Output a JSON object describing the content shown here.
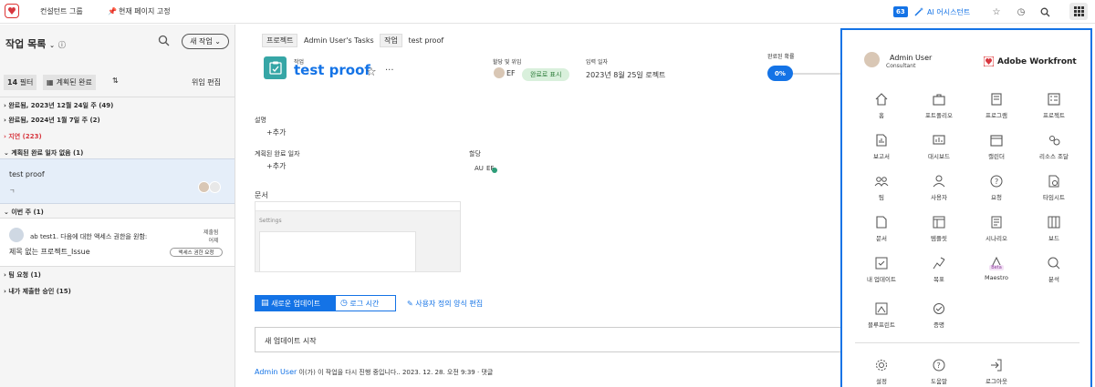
{
  "topbar": {
    "link1": "컨설턴트 그룹",
    "link2": "현재 페이지 고정",
    "badge": "63",
    "ai": "AI 어시스턴트"
  },
  "left": {
    "title": "작업 목록",
    "new_button": "새 작업",
    "filter_count": "14",
    "filter_label": "필터",
    "planned_done": "계획된 완료",
    "delegate_edit": "위임 편집",
    "sections": [
      {
        "label": "완료됨, 2023년 12월 24일 주 (49)",
        "red": false
      },
      {
        "label": "완료됨, 2024년 1월 7일 주 (2)",
        "red": false
      },
      {
        "label": "지연 (223)",
        "red": true
      },
      {
        "label": "계획된 완료 일자 없음 (1)",
        "red": false
      }
    ],
    "selected_item": "test proof",
    "selected_sub": "ㄱ",
    "this_week": "이번 주 (1)",
    "access_request": "ab test1. 다음에 대한 액세스 권한을 원함:",
    "access_project": "제목 없는 프로젝트_Issue",
    "access_status1": "제출됨",
    "access_status2": "어제",
    "access_button": "액세스 권한 요청",
    "team_requests": "팀 요청 (1)",
    "my_approvals": "내가 제출한 승인 (15)"
  },
  "main": {
    "crumb_project_label": "프로젝트",
    "crumb_project": "Admin User's Tasks",
    "crumb_task_label": "작업",
    "crumb_task": "test proof",
    "task_type": "작업",
    "title": "test proof",
    "assign_label": "할당 및 위임",
    "assign_initials": "EF",
    "assign_pill": "완료로 표시",
    "entry_label": "입력 일자",
    "entry_value": "2023년 8월 25일 로젝트",
    "complete_label": "완료된 확률",
    "complete_pct": "0%",
    "desc_label": "설명",
    "desc_add": "+추가",
    "planned_label": "계획된 완료 일자",
    "planned_add": "+추가",
    "assign2_label": "할당",
    "assign2_a": "AU",
    "assign2_b": "EF",
    "doc_label": "문서",
    "doc_settings": "Settings",
    "tab_updates": "새로운 업데이트",
    "tab_log": "로그 시간",
    "edit_custom": "사용자 정의 양식 편집",
    "update_placeholder": "새 업데이트 시작",
    "footer_user": "Admin User",
    "footer_text": "이(가) 이 작업을 다시 진행 중입니다.. 2023. 12. 28. 오전 9:39 ·",
    "footer_reply": "댓글"
  },
  "panel": {
    "user_name": "Admin User",
    "user_role": "Consultant",
    "brand": "Adobe Workfront",
    "apps": [
      {
        "label": "홈",
        "icon": "home-icon"
      },
      {
        "label": "포트폴리오",
        "icon": "portfolio-icon"
      },
      {
        "label": "프로그램",
        "icon": "program-icon"
      },
      {
        "label": "프로젝트",
        "icon": "project-icon"
      },
      {
        "label": "보고서",
        "icon": "report-icon"
      },
      {
        "label": "대시보드",
        "icon": "dashboard-icon"
      },
      {
        "label": "캘린더",
        "icon": "calendar-icon"
      },
      {
        "label": "리소스 조달",
        "icon": "resource-icon"
      },
      {
        "label": "팀",
        "icon": "team-icon"
      },
      {
        "label": "사용자",
        "icon": "user-icon"
      },
      {
        "label": "요청",
        "icon": "request-icon"
      },
      {
        "label": "타임시트",
        "icon": "timesheet-icon"
      },
      {
        "label": "문서",
        "icon": "document-icon"
      },
      {
        "label": "템플릿",
        "icon": "template-icon"
      },
      {
        "label": "시나리오",
        "icon": "scenario-icon"
      },
      {
        "label": "보드",
        "icon": "board-icon"
      },
      {
        "label": "내 업데이트",
        "icon": "my-updates-icon"
      },
      {
        "label": "목표",
        "icon": "goals-icon"
      },
      {
        "label": "Maestro",
        "icon": "maestro-icon",
        "badge": "Beta"
      },
      {
        "label": "분석",
        "icon": "analytics-icon"
      },
      {
        "label": "블루프린트",
        "icon": "blueprint-icon"
      },
      {
        "label": "증명",
        "icon": "proof-icon"
      }
    ],
    "bottom": [
      {
        "label": "설정",
        "icon": "settings-icon"
      },
      {
        "label": "도움말",
        "icon": "help-icon"
      },
      {
        "label": "로그아웃",
        "icon": "logout-icon"
      }
    ]
  }
}
